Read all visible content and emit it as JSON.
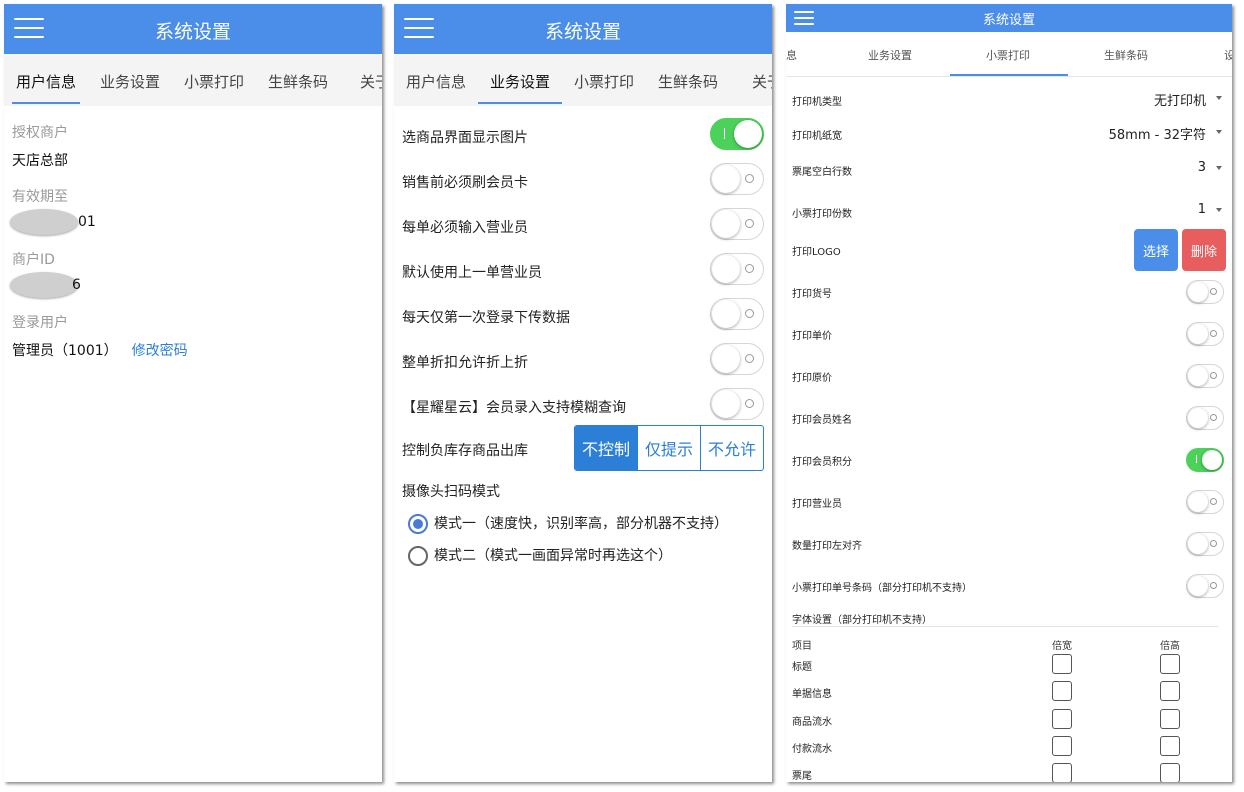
{
  "app_title": "系统设置",
  "colors": {
    "primary": "#4a8eea",
    "switch_on": "#4cd15a",
    "delete": "#e85d5d",
    "link": "#2b7fd6"
  },
  "panel1": {
    "tabs": [
      "用户信息",
      "业务设置",
      "小票打印",
      "生鲜条码",
      "关于"
    ],
    "active_tab": 0,
    "fields": {
      "auth_merchant_label": "授权商户",
      "auth_merchant_value": "天店总部",
      "valid_until_label": "有效期至",
      "valid_until_suffix": "01",
      "merchant_id_label": "商户ID",
      "merchant_id_suffix": "6",
      "login_user_label": "登录用户",
      "login_user_value": "管理员（1001）",
      "change_password": "修改密码"
    }
  },
  "panel2": {
    "tabs": [
      "用户信息",
      "业务设置",
      "小票打印",
      "生鲜条码",
      "关于"
    ],
    "active_tab": 1,
    "toggles": [
      {
        "label": "选商品界面显示图片",
        "on": true
      },
      {
        "label": "销售前必须刷会员卡",
        "on": false
      },
      {
        "label": "每单必须输入营业员",
        "on": false
      },
      {
        "label": "默认使用上一单营业员",
        "on": false
      },
      {
        "label": "每天仅第一次登录下传数据",
        "on": false
      },
      {
        "label": "整单折扣允许折上折",
        "on": false
      },
      {
        "label": "【星耀星云】会员录入支持模糊查询",
        "on": false
      }
    ],
    "negative_stock_label": "控制负库存商品出库",
    "negative_stock_options": [
      "不控制",
      "仅提示",
      "不允许"
    ],
    "negative_stock_selected": 0,
    "camera_mode_label": "摄像头扫码模式",
    "camera_modes": [
      {
        "label": "模式一（速度快，识别率高，部分机器不支持）",
        "checked": true
      },
      {
        "label": "模式二（模式一画面异常时再选这个）",
        "checked": false
      }
    ]
  },
  "panel3": {
    "tabs": [
      "息",
      "业务设置",
      "小票打印",
      "生鲜条码",
      "设"
    ],
    "active_tab": 2,
    "selects": [
      {
        "label": "打印机类型",
        "value": "无打印机"
      },
      {
        "label": "打印机纸宽",
        "value": "58mm - 32字符"
      },
      {
        "label": "票尾空白行数",
        "value": "3"
      },
      {
        "label": "小票打印份数",
        "value": "1"
      }
    ],
    "logo_label": "打印LOGO",
    "logo_select": "选择",
    "logo_delete": "删除",
    "toggles": [
      {
        "label": "打印货号",
        "on": false
      },
      {
        "label": "打印单价",
        "on": false
      },
      {
        "label": "打印原价",
        "on": false
      },
      {
        "label": "打印会员姓名",
        "on": false
      },
      {
        "label": "打印会员积分",
        "on": true
      },
      {
        "label": "打印营业员",
        "on": false
      },
      {
        "label": "数量打印左对齐",
        "on": false
      },
      {
        "label": "小票打印单号条码（部分打印机不支持）",
        "on": false
      }
    ],
    "font_section_title": "字体设置（部分打印机不支持）",
    "font_headers": [
      "项目",
      "倍宽",
      "倍高"
    ],
    "font_rows": [
      "标题",
      "单据信息",
      "商品流水",
      "付款流水",
      "票尾"
    ]
  }
}
